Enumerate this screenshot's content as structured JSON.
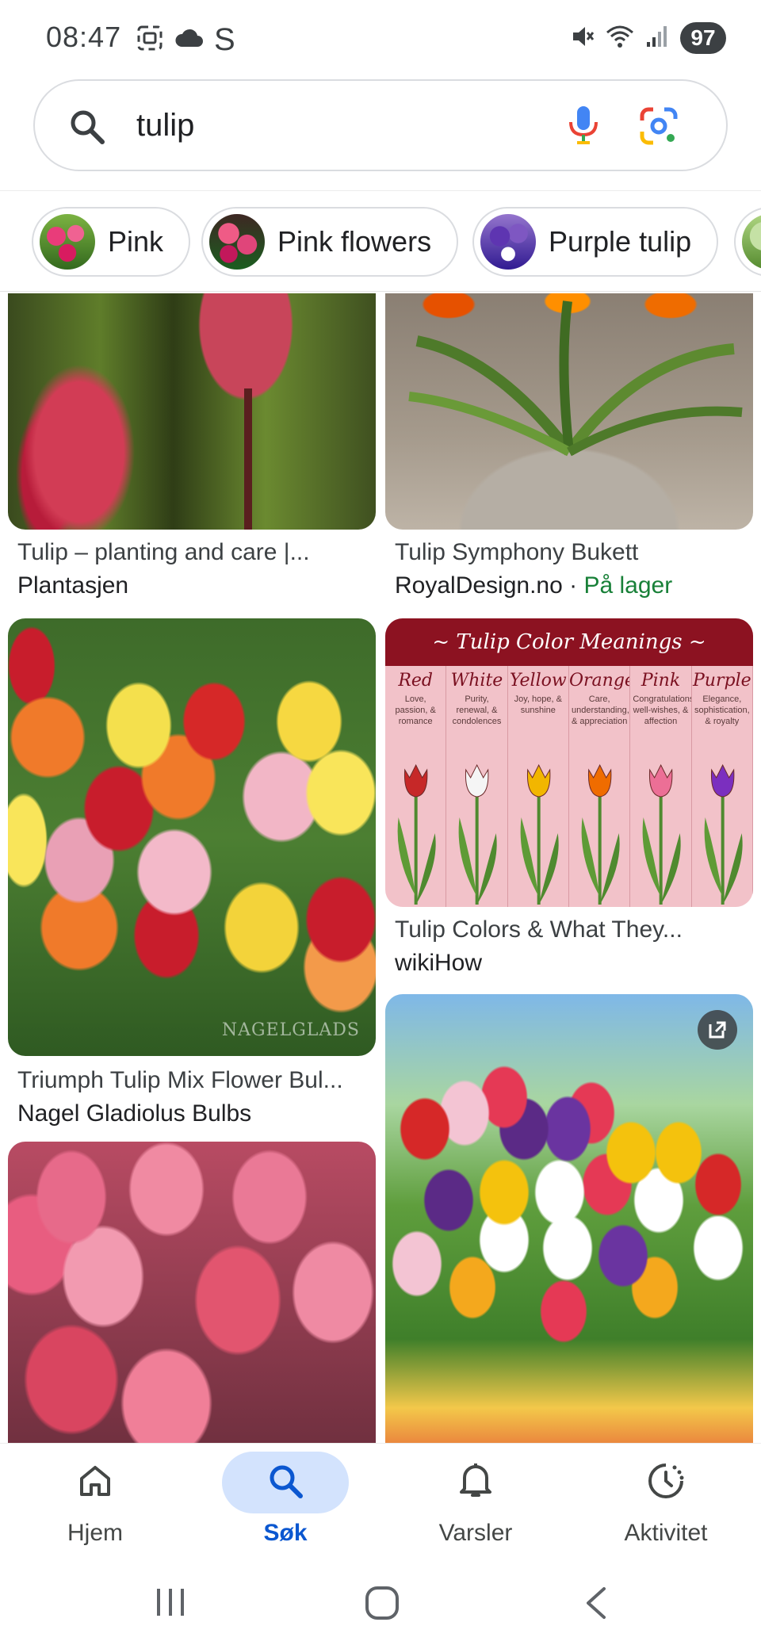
{
  "status_bar": {
    "time": "08:47",
    "left_icons": [
      "screenshot-icon",
      "cloud-icon",
      "s-icon"
    ],
    "s_glyph": "S",
    "right_icons": [
      "mute-icon",
      "wifi-icon",
      "signal-icon"
    ],
    "battery": "97"
  },
  "search": {
    "query": "tulip",
    "icons": [
      "search-icon",
      "mic-icon",
      "lens-icon"
    ]
  },
  "chips": [
    {
      "label": "Pink"
    },
    {
      "label": "Pink flowers"
    },
    {
      "label": "Purple tulip"
    }
  ],
  "results": [
    {
      "title": "Tulip – planting and care |...",
      "source": "Plantasjen"
    },
    {
      "title": "Tulip Symphony Bukett",
      "source": "RoyalDesign.no",
      "separator": " · ",
      "stock": "På lager"
    },
    {
      "title": "Triumph Tulip Mix Flower Bul...",
      "source": "Nagel Gladiolus Bulbs",
      "watermark": "NAGELGLADS"
    },
    {
      "title": "Tulip Colors & What They...",
      "source": "wikiHow",
      "infographic": {
        "heading": "~ Tulip Color Meanings ~",
        "columns": [
          {
            "name": "Red",
            "meaning": "Love, passion, & romance",
            "color": "#c62828"
          },
          {
            "name": "White",
            "meaning": "Purity, renewal, & condolences",
            "color": "#f5f5f5"
          },
          {
            "name": "Yellow",
            "meaning": "Joy, hope, & sunshine",
            "color": "#f2b600"
          },
          {
            "name": "Orange",
            "meaning": "Care, understanding, & appreciation",
            "color": "#ef6c00"
          },
          {
            "name": "Pink",
            "meaning": "Congratulations, well-wishes, & affection",
            "color": "#ec6f96"
          },
          {
            "name": "Purple",
            "meaning": "Elegance, sophistication, & royalty",
            "color": "#7b2fbf"
          }
        ]
      }
    },
    {
      "title": "",
      "source": ""
    },
    {
      "title": "",
      "source": "",
      "has_open_icon": true
    }
  ],
  "bottom_nav": [
    {
      "label": "Hjem",
      "icon": "home-icon"
    },
    {
      "label": "Søk",
      "icon": "search-icon",
      "active": true
    },
    {
      "label": "Varsler",
      "icon": "bell-icon"
    },
    {
      "label": "Aktivitet",
      "icon": "activity-icon"
    }
  ],
  "system_nav": [
    "recents-icon",
    "home-button-icon",
    "back-icon"
  ],
  "colors": {
    "accent": "#0b57d0",
    "active_nav_bg": "#d3e3fd",
    "in_stock": "#188038",
    "battery_bg": "#3c4043"
  }
}
